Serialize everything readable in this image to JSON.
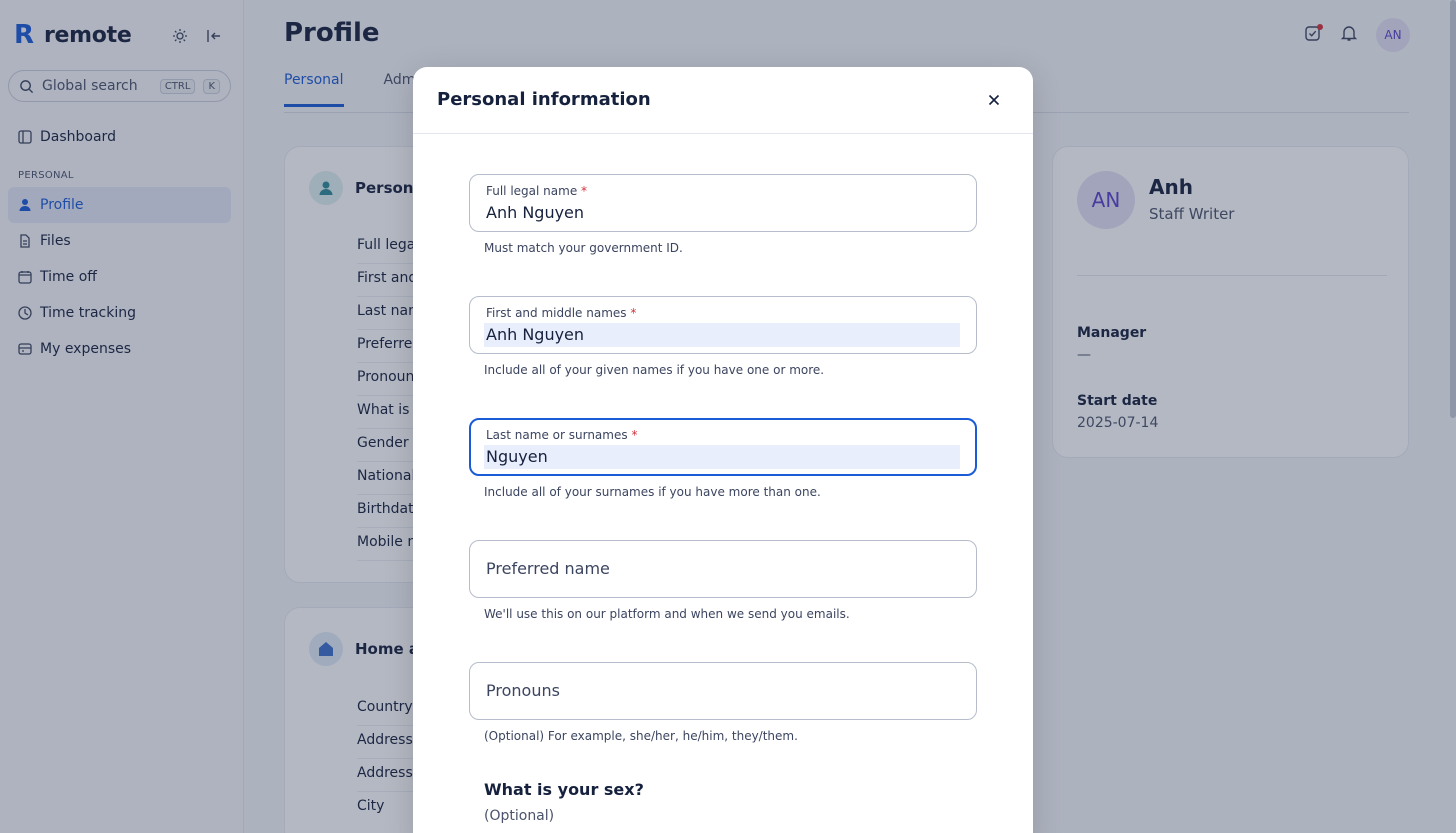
{
  "brand": {
    "name": "remote",
    "logo_letter": "R"
  },
  "sidebar": {
    "search_placeholder": "Global search",
    "search_kbd": [
      "CTRL",
      "K"
    ],
    "section_label": "PERSONAL",
    "items": [
      {
        "label": "Dashboard",
        "icon": "dashboard-icon"
      },
      {
        "label": "Profile",
        "icon": "person-icon",
        "active": true
      },
      {
        "label": "Files",
        "icon": "file-icon"
      },
      {
        "label": "Time off",
        "icon": "calendar-icon"
      },
      {
        "label": "Time tracking",
        "icon": "clock-icon"
      },
      {
        "label": "My expenses",
        "icon": "receipt-icon"
      }
    ]
  },
  "header": {
    "title": "Profile",
    "tabs": [
      {
        "label": "Personal",
        "active": true
      },
      {
        "label": "Adm"
      }
    ],
    "avatar_initials": "AN"
  },
  "personal_card": {
    "title": "Person",
    "rows": [
      "Full legal",
      "First and",
      "Last nam",
      "Preferre",
      "Pronoun",
      "What is y",
      "Gender i",
      "Nationali",
      "Birthdate",
      "Mobile n"
    ]
  },
  "home_card": {
    "title": "Home a",
    "rows": [
      "Country",
      "Address",
      "Address",
      "City"
    ]
  },
  "summary_card": {
    "initials": "AN",
    "name": "Anh",
    "role": "Staff Writer",
    "manager_label": "Manager",
    "manager_value": "—",
    "start_label": "Start date",
    "start_value": "2025-07-14"
  },
  "modal": {
    "title": "Personal information",
    "close_icon": "close-icon",
    "fields": {
      "full_legal_name": {
        "label": "Full legal name",
        "value": "Anh Nguyen",
        "hint": "Must match your government ID."
      },
      "first_middle": {
        "label": "First and middle names",
        "value": "Anh Nguyen",
        "hint": "Include all of your given names if you have one or more."
      },
      "last_name": {
        "label": "Last name or surnames",
        "value": "Nguyen",
        "hint": "Include all of your surnames if you have more than one."
      },
      "preferred": {
        "placeholder": "Preferred name",
        "hint": "We'll use this on our platform and when we send you emails."
      },
      "pronouns": {
        "placeholder": "Pronouns",
        "hint": "(Optional) For example, she/her, he/him, they/them."
      }
    },
    "sex_question": "What is your sex?",
    "sex_sub": "(Optional)"
  },
  "colors": {
    "accent": "#1a5bd6",
    "required": "#d6303a",
    "avatar_bg": "#e3e1f5"
  }
}
